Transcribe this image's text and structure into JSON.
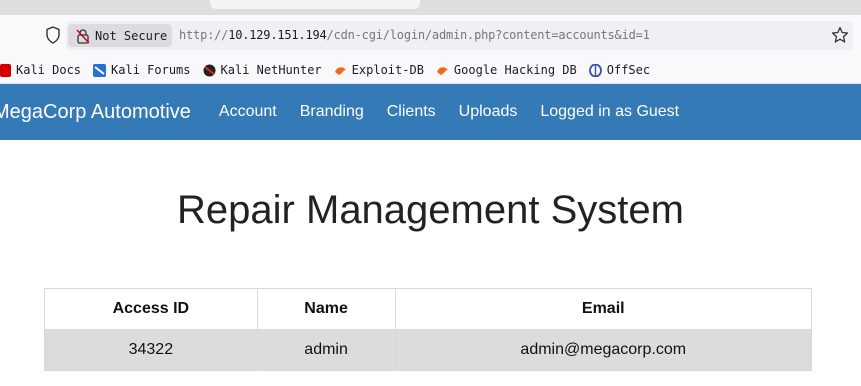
{
  "browser": {
    "security_label": "Not Secure",
    "url_prefix": "http://",
    "url_host": "10.129.151.194",
    "url_path": "/cdn-cgi/login/admin.php?content=accounts&id=1",
    "bookmarks": [
      {
        "label": "Kali Docs",
        "icon": "kali-docs-icon"
      },
      {
        "label": "Kali Forums",
        "icon": "kali-forums-icon"
      },
      {
        "label": "Kali NetHunter",
        "icon": "kali-nethunter-icon"
      },
      {
        "label": "Exploit-DB",
        "icon": "exploit-db-icon"
      },
      {
        "label": "Google Hacking DB",
        "icon": "ghdb-icon"
      },
      {
        "label": "OffSec",
        "icon": "offsec-icon"
      }
    ]
  },
  "nav": {
    "brand": "MegaCorp Automotive",
    "links": [
      "Account",
      "Branding",
      "Clients",
      "Uploads",
      "Logged in as Guest"
    ]
  },
  "main": {
    "title": "Repair Management System",
    "table": {
      "headers": [
        "Access ID",
        "Name",
        "Email"
      ],
      "rows": [
        [
          "34322",
          "admin",
          "admin@megacorp.com"
        ]
      ]
    }
  },
  "colors": {
    "navbar": "#337ab7",
    "row_bg": "#dcdcdc"
  }
}
